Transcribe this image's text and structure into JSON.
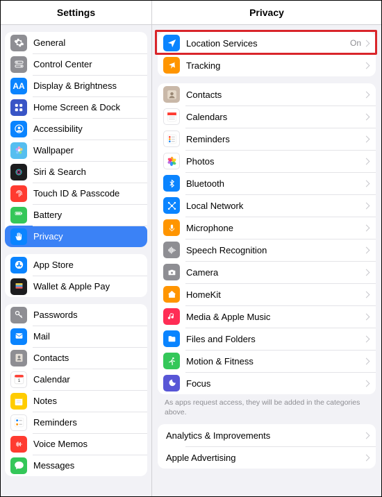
{
  "sidebar": {
    "title": "Settings",
    "groups": [
      {
        "items": [
          {
            "id": "general",
            "label": "General",
            "icon": "gear",
            "bg": "#8e8e93"
          },
          {
            "id": "control-center",
            "label": "Control Center",
            "icon": "toggles",
            "bg": "#8e8e93"
          },
          {
            "id": "display",
            "label": "Display & Brightness",
            "icon": "AA",
            "bg": "#0a84ff"
          },
          {
            "id": "home-screen",
            "label": "Home Screen & Dock",
            "icon": "grid",
            "bg": "#3955c6"
          },
          {
            "id": "accessibility",
            "label": "Accessibility",
            "icon": "person",
            "bg": "#0a84ff"
          },
          {
            "id": "wallpaper",
            "label": "Wallpaper",
            "icon": "flower",
            "bg": "#55bef0"
          },
          {
            "id": "siri",
            "label": "Siri & Search",
            "icon": "siri",
            "bg": "#1c1c1e"
          },
          {
            "id": "touchid",
            "label": "Touch ID & Passcode",
            "icon": "fingerprint",
            "bg": "#ff3b30"
          },
          {
            "id": "battery",
            "label": "Battery",
            "icon": "battery",
            "bg": "#34c759"
          },
          {
            "id": "privacy",
            "label": "Privacy",
            "icon": "hand",
            "bg": "#0a84ff",
            "selected": true
          }
        ]
      },
      {
        "items": [
          {
            "id": "appstore",
            "label": "App Store",
            "icon": "appstore",
            "bg": "#0a84ff"
          },
          {
            "id": "wallet",
            "label": "Wallet & Apple Pay",
            "icon": "wallet",
            "bg": "#1c1c1e"
          }
        ]
      },
      {
        "items": [
          {
            "id": "passwords",
            "label": "Passwords",
            "icon": "key",
            "bg": "#8e8e93"
          },
          {
            "id": "mail",
            "label": "Mail",
            "icon": "mail",
            "bg": "#0a84ff"
          },
          {
            "id": "contacts",
            "label": "Contacts",
            "icon": "contacts",
            "bg": "#8e8e93"
          },
          {
            "id": "calendar",
            "label": "Calendar",
            "icon": "calendar",
            "bg": "#ffffff",
            "fg": "#000"
          },
          {
            "id": "notes",
            "label": "Notes",
            "icon": "notes",
            "bg": "#ffcc00"
          },
          {
            "id": "reminders",
            "label": "Reminders",
            "icon": "reminders",
            "bg": "#ffffff",
            "fg": "#000"
          },
          {
            "id": "voicememos",
            "label": "Voice Memos",
            "icon": "voice",
            "bg": "#ff3b30"
          },
          {
            "id": "messages",
            "label": "Messages",
            "icon": "messages",
            "bg": "#34c759"
          }
        ]
      }
    ]
  },
  "main": {
    "title": "Privacy",
    "groups": [
      {
        "items": [
          {
            "id": "location",
            "label": "Location Services",
            "icon": "location",
            "bg": "#0a84ff",
            "value": "On",
            "highlight": true
          },
          {
            "id": "tracking",
            "label": "Tracking",
            "icon": "tracking",
            "bg": "#ff9500"
          }
        ]
      },
      {
        "items": [
          {
            "id": "contacts2",
            "label": "Contacts",
            "icon": "contacts2",
            "bg": "#c9b8a8"
          },
          {
            "id": "calendars",
            "label": "Calendars",
            "icon": "calendars",
            "bg": "#ffffff",
            "fg": "#ff3b30"
          },
          {
            "id": "reminders2",
            "label": "Reminders",
            "icon": "reminders2",
            "bg": "#ffffff"
          },
          {
            "id": "photos",
            "label": "Photos",
            "icon": "photos",
            "bg": "#ffffff"
          },
          {
            "id": "bluetooth",
            "label": "Bluetooth",
            "icon": "bluetooth",
            "bg": "#0a84ff"
          },
          {
            "id": "localnet",
            "label": "Local Network",
            "icon": "localnet",
            "bg": "#0a84ff"
          },
          {
            "id": "mic",
            "label": "Microphone",
            "icon": "mic",
            "bg": "#ff9500"
          },
          {
            "id": "speech",
            "label": "Speech Recognition",
            "icon": "speech",
            "bg": "#8e8e93"
          },
          {
            "id": "camera",
            "label": "Camera",
            "icon": "camera",
            "bg": "#8e8e93"
          },
          {
            "id": "homekit",
            "label": "HomeKit",
            "icon": "home",
            "bg": "#ff9500"
          },
          {
            "id": "media",
            "label": "Media & Apple Music",
            "icon": "music",
            "bg": "#ff2d55"
          },
          {
            "id": "files",
            "label": "Files and Folders",
            "icon": "folder",
            "bg": "#0a84ff"
          },
          {
            "id": "motion",
            "label": "Motion & Fitness",
            "icon": "motion",
            "bg": "#34c759"
          },
          {
            "id": "focus",
            "label": "Focus",
            "icon": "moon",
            "bg": "#5856d6"
          }
        ],
        "footnote": "As apps request access, they will be added in the categories above."
      },
      {
        "items": [
          {
            "id": "analytics",
            "label": "Analytics & Improvements"
          },
          {
            "id": "ads",
            "label": "Apple Advertising"
          }
        ]
      }
    ]
  }
}
